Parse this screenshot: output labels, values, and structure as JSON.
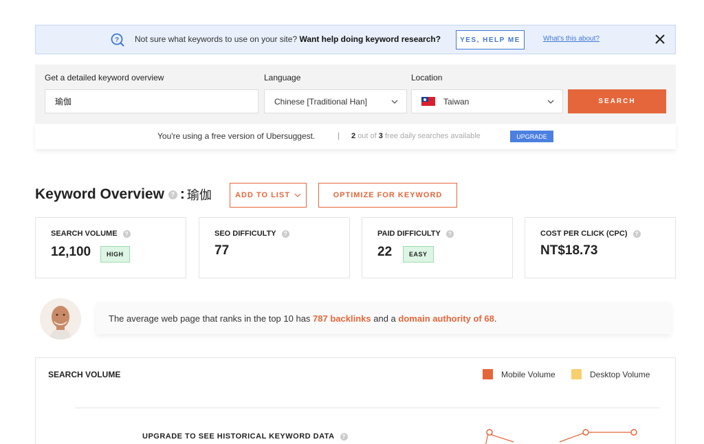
{
  "banner": {
    "text_plain": "Not sure what keywords to use on your site?",
    "text_bold": "Want help doing keyword research?",
    "yes_button": "YES, HELP ME",
    "whats_link": "What's this about?"
  },
  "search": {
    "keyword_label": "Get a detailed keyword overview",
    "keyword_value": "瑜伽",
    "language_label": "Language",
    "language_value": "Chinese [Traditional Han]",
    "location_label": "Location",
    "location_value": "Taiwan",
    "search_button": "SEARCH"
  },
  "free": {
    "text": "You're using a free version of Ubersuggest.",
    "separator": "|",
    "used": "2",
    "out_of": "out of",
    "total": "3",
    "suffix": "free daily searches available",
    "upgrade": "UPGRADE"
  },
  "overview": {
    "title": "Keyword Overview",
    "colon": ":",
    "term": "瑜伽",
    "add_to_list": "ADD TO LIST",
    "optimize": "OPTIMIZE FOR KEYWORD"
  },
  "cards": [
    {
      "label": "SEARCH VOLUME",
      "value": "12,100",
      "badge": "HIGH"
    },
    {
      "label": "SEO DIFFICULTY",
      "value": "77"
    },
    {
      "label": "PAID DIFFICULTY",
      "value": "22",
      "badge": "EASY"
    },
    {
      "label": "COST PER CLICK (CPC)",
      "value": "NT$18.73"
    }
  ],
  "tip": {
    "prefix": "The average web page that ranks in the top 10 has",
    "backlinks": "787 backlinks",
    "middle": "and a",
    "authority": "domain authority of 68",
    "suffix": "."
  },
  "search_volume": {
    "title": "SEARCH VOLUME",
    "legend_mobile": "Mobile Volume",
    "legend_desktop": "Desktop Volume",
    "upgrade_text": "UPGRADE TO SEE HISTORICAL KEYWORD DATA"
  },
  "colors": {
    "accent": "#e5663a",
    "link_blue": "#3f77d4",
    "mobile": "#e5663a",
    "desktop": "#f7cf6e",
    "badge_green": "#ddf5e4"
  },
  "icons": [
    "question-search-icon",
    "close-icon",
    "chevron-down-icon",
    "taiwan-flag-icon",
    "help-icon"
  ]
}
